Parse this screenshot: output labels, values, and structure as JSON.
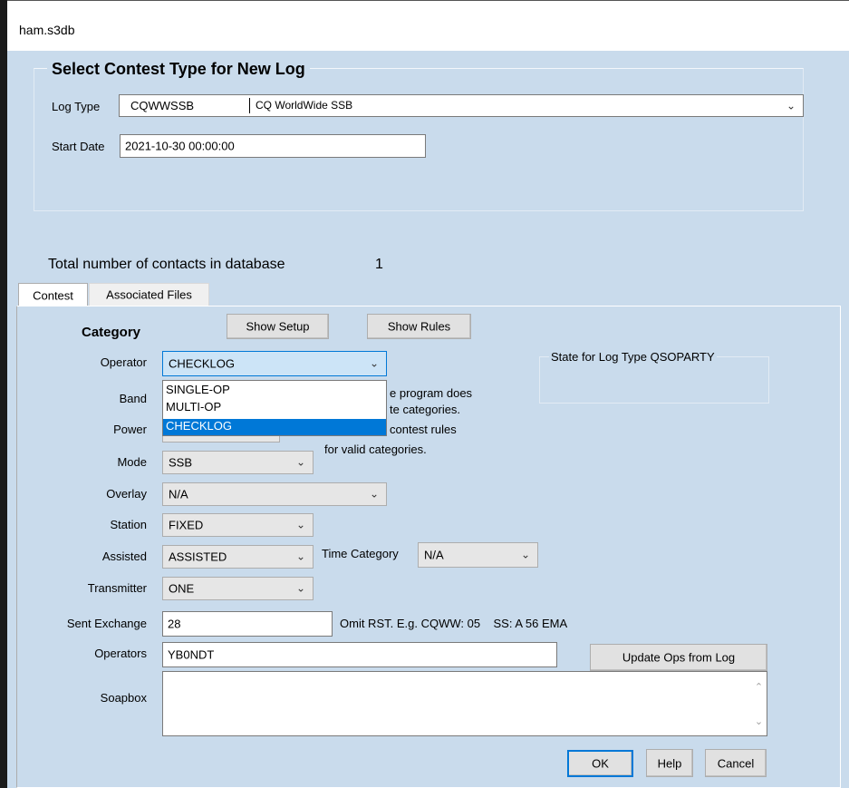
{
  "window": {
    "title": "ham.s3db"
  },
  "contest_select": {
    "title": "Select Contest Type for New Log",
    "log_type_label": "Log Type",
    "log_type_code": "CQWWSSB",
    "log_type_name": "CQ WorldWide SSB",
    "start_date_label": "Start Date",
    "start_date_value": "2021-10-30 00:00:00"
  },
  "summary": {
    "total_label": "Total number of contacts in database",
    "total_value": "1"
  },
  "tabs": [
    {
      "label": "Contest",
      "active": true
    },
    {
      "label": "Associated Files",
      "active": false
    }
  ],
  "category": {
    "heading": "Category",
    "show_setup": "Show Setup",
    "show_rules": "Show Rules",
    "operator_label": "Operator",
    "operator_value": "CHECKLOG",
    "operator_options": [
      "SINGLE-OP",
      "MULTI-OP",
      "CHECKLOG"
    ],
    "operator_selected_index": 2,
    "band_label": "Band",
    "power_label": "Power",
    "info_line1": "e program does",
    "info_line2": "te categories.",
    "info_line3": "contest rules",
    "info_line4": "for valid categories.",
    "mode_label": "Mode",
    "mode_value": "SSB",
    "overlay_label": "Overlay",
    "overlay_value": "N/A",
    "station_label": "Station",
    "station_value": "FIXED",
    "assisted_label": "Assisted",
    "assisted_value": "ASSISTED",
    "time_category_label": "Time Category",
    "time_category_value": "N/A",
    "transmitter_label": "Transmitter",
    "transmitter_value": "ONE",
    "sent_exchange_label": "Sent Exchange",
    "sent_exchange_value": "28",
    "sent_exchange_hint": "Omit RST. E.g. CQWW: 05    SS: A 56 EMA",
    "operators_label": "Operators",
    "operators_value": "YB0NDT",
    "update_ops_button": "Update Ops from Log",
    "soapbox_label": "Soapbox",
    "soapbox_value": "",
    "state_box_label": "State for Log Type QSOPARTY"
  },
  "footer": {
    "ok": "OK",
    "help": "Help",
    "cancel": "Cancel"
  },
  "icons": {
    "dropdown": "chevron-down-icon",
    "scroll_up": "scroll-up-arrow-icon",
    "scroll_down": "scroll-down-arrow-icon"
  },
  "colors": {
    "client_bg": "#c9dbec",
    "selection": "#0078d7",
    "focus_combo": "#cce4f7"
  }
}
